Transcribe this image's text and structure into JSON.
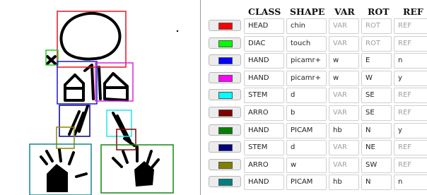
{
  "canvas": {
    "boxes": [
      {
        "name": "head-box",
        "color": "#e8141e"
      },
      {
        "name": "diac-box",
        "color": "#22cc22"
      },
      {
        "name": "hand-left-box",
        "color": "#1a1acc"
      },
      {
        "name": "hand-right-box",
        "color": "#dd22dd"
      },
      {
        "name": "stem-right-box",
        "color": "#22e6e6"
      },
      {
        "name": "arro-right-box",
        "color": "#880000"
      },
      {
        "name": "hand-lower-right-box",
        "color": "#118811"
      },
      {
        "name": "stem-left-box",
        "color": "#000088"
      },
      {
        "name": "arro-left-box",
        "color": "#888800"
      },
      {
        "name": "hand-lower-left-box",
        "color": "#118888"
      }
    ]
  },
  "table": {
    "headers": {
      "class": "CLASS",
      "shape": "SHAPE",
      "var": "VAR",
      "rot": "ROT",
      "ref": "REF"
    },
    "rows": [
      {
        "color": "#ff0000",
        "class": "HEAD",
        "shape": "chin",
        "var": "VAR",
        "rot": "ROT",
        "ref": "REF"
      },
      {
        "color": "#00ff00",
        "class": "DIAC",
        "shape": "touch",
        "var": "VAR",
        "rot": "ROT",
        "ref": "REF"
      },
      {
        "color": "#0000ff",
        "class": "HAND",
        "shape": "picamr+",
        "var": "w",
        "rot": "E",
        "ref": "n"
      },
      {
        "color": "#ff00ff",
        "class": "HAND",
        "shape": "picamr+",
        "var": "w",
        "rot": "W",
        "ref": "y"
      },
      {
        "color": "#00ffff",
        "class": "STEM",
        "shape": "d",
        "var": "VAR",
        "rot": "SE",
        "ref": "REF"
      },
      {
        "color": "#800000",
        "class": "ARRO",
        "shape": "b",
        "var": "VAR",
        "rot": "SE",
        "ref": "REF"
      },
      {
        "color": "#008000",
        "class": "HAND",
        "shape": "PICAM",
        "var": "hb",
        "rot": "N",
        "ref": "y"
      },
      {
        "color": "#000080",
        "class": "STEM",
        "shape": "d",
        "var": "VAR",
        "rot": "NE",
        "ref": "REF"
      },
      {
        "color": "#808000",
        "class": "ARRO",
        "shape": "w",
        "var": "VAR",
        "rot": "SW",
        "ref": "REF"
      },
      {
        "color": "#008080",
        "class": "HAND",
        "shape": "PICAM",
        "var": "hb",
        "rot": "N",
        "ref": "n"
      }
    ]
  }
}
